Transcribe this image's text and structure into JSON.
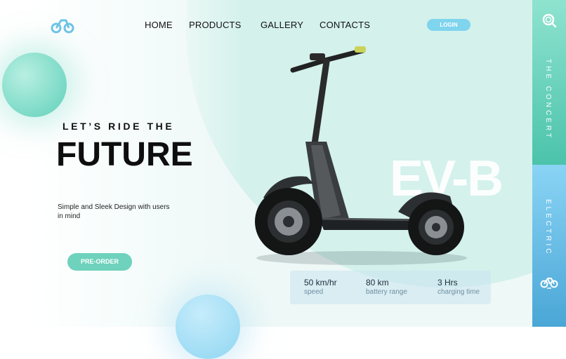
{
  "nav": {
    "items": [
      "HOME",
      "PRODUCTS",
      "GALLERY",
      "CONTACTS"
    ],
    "login": "LOGIN"
  },
  "hero": {
    "tagline": "LET’S RIDE THE",
    "title": "FUTURE",
    "description": "Simple and Sleek Design with users in mind",
    "cta": "PRE-ORDER",
    "model": "EV-B"
  },
  "stats": [
    {
      "value": "50 km/hr",
      "label": "speed"
    },
    {
      "value": "80 km",
      "label": "battery range"
    },
    {
      "value": "3 Hrs",
      "label": "charging time"
    }
  ],
  "sidebar": {
    "top_label": "THE CONCERT",
    "bottom_label": "ELECTRIC"
  },
  "icons": {
    "logo": "bike-logo-icon",
    "search": "search-icon",
    "bike": "bike-icon"
  },
  "colors": {
    "mint": "#6ed2bc",
    "sky": "#7fd4ee",
    "sidebar_top": "#4cc3ab",
    "sidebar_bottom": "#4aa6d6"
  }
}
